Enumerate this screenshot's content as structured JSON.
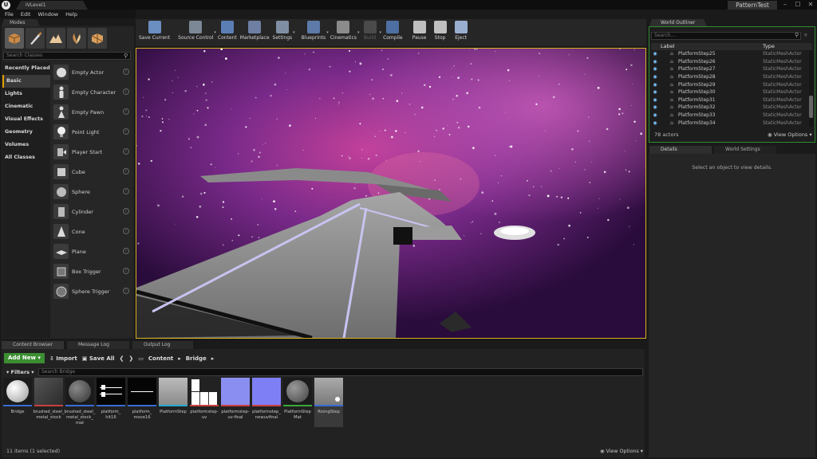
{
  "titlebar": {
    "level_tab": "IVLevel1",
    "project": "PatternTest",
    "min": "–",
    "max": "☐",
    "close": "✕"
  },
  "menu": [
    "File",
    "Edit",
    "Window",
    "Help"
  ],
  "modes": {
    "tab": "Modes",
    "search_placeholder": "Search Classes",
    "categories": [
      "Recently Placed",
      "Basic",
      "Lights",
      "Cinematic",
      "Visual Effects",
      "Geometry",
      "Volumes",
      "All Classes"
    ],
    "selected_category": "Basic",
    "actors": [
      "Empty Actor",
      "Empty Character",
      "Empty Pawn",
      "Point Light",
      "Player Start",
      "Cube",
      "Sphere",
      "Cylinder",
      "Cone",
      "Plane",
      "Box Trigger",
      "Sphere Trigger"
    ]
  },
  "toolbar": [
    {
      "label": "Save Current",
      "icon": "save-icon",
      "color": "#6a8fc0"
    },
    {
      "label": "Source Control",
      "icon": "source-control-icon",
      "color": "#7c8896",
      "arrow": true
    },
    {
      "label": "Content",
      "icon": "content-icon",
      "color": "#5b7fb5"
    },
    {
      "label": "Marketplace",
      "icon": "marketplace-icon",
      "color": "#6e7fa3"
    },
    {
      "label": "Settings",
      "icon": "settings-icon",
      "color": "#7f8ea3",
      "arrow": true
    },
    {
      "label": "Blueprints",
      "icon": "blueprints-icon",
      "color": "#5d7aa8",
      "arrow": true
    },
    {
      "label": "Cinematics",
      "icon": "cinematics-icon",
      "color": "#8b8b8b",
      "arrow": true
    },
    {
      "label": "Build",
      "icon": "build-icon",
      "color": "#4a4a4a",
      "arrow": true,
      "dim": true
    },
    {
      "label": "Compile",
      "icon": "compile-icon",
      "color": "#4d6fa1"
    },
    {
      "label": "Pause",
      "icon": "pause-icon",
      "color": "#bfbfbf"
    },
    {
      "label": "Stop",
      "icon": "stop-icon",
      "color": "#bfbfbf"
    },
    {
      "label": "Eject",
      "icon": "eject-icon",
      "color": "#9aaed0"
    }
  ],
  "outliner": {
    "tab": "World Outliner",
    "search_placeholder": "Search...",
    "col_label": "Label",
    "col_type": "Type",
    "rows": [
      {
        "label": "PlatformStep25",
        "type": "StaticMeshActor"
      },
      {
        "label": "PlatformStep26",
        "type": "StaticMeshActor"
      },
      {
        "label": "PlatformStep27",
        "type": "StaticMeshActor"
      },
      {
        "label": "PlatformStep28",
        "type": "StaticMeshActor"
      },
      {
        "label": "PlatformStep29",
        "type": "StaticMeshActor"
      },
      {
        "label": "PlatformStep30",
        "type": "StaticMeshActor"
      },
      {
        "label": "PlatformStep31",
        "type": "StaticMeshActor"
      },
      {
        "label": "PlatformStep32",
        "type": "StaticMeshActor"
      },
      {
        "label": "PlatformStep33",
        "type": "StaticMeshActor"
      },
      {
        "label": "PlatformStep34",
        "type": "StaticMeshActor"
      }
    ],
    "count": "78 actors",
    "view_options": "View Options"
  },
  "details": {
    "tab": "Details",
    "world_settings_tab": "World Settings",
    "empty_msg": "Select an object to view details."
  },
  "bottom_tabs": [
    "Content Browser",
    "Message Log",
    "Output Log"
  ],
  "content_browser": {
    "add_new": "Add New",
    "import": "Import",
    "save_all": "Save All",
    "crumbs": [
      "Content",
      "Bridge"
    ],
    "filters": "Filters",
    "search_placeholder": "Search Bridge",
    "assets": [
      {
        "name": "Bridge",
        "bar": "#3a6bd6",
        "kind": "sphere-white"
      },
      {
        "name": "brushed_steel_\nmetal_stock",
        "bar": "#c84040",
        "kind": "dark"
      },
      {
        "name": "brushed_steel_\nmetal_stock_\nmat",
        "bar": "#3a6bd6",
        "kind": "sphere-dark"
      },
      {
        "name": "platform_\nhit16",
        "bar": "#3a6bd6",
        "kind": "black-lines"
      },
      {
        "name": "platform_\nmove16",
        "bar": "#3a6bd6",
        "kind": "black-line"
      },
      {
        "name": "PlatformStep",
        "bar": "#25a8d0",
        "kind": "grey"
      },
      {
        "name": "platformstep-\nuv",
        "bar": "#c84040",
        "kind": "uv"
      },
      {
        "name": "platformstep-\nuv-final",
        "bar": "#c84040",
        "kind": "blue"
      },
      {
        "name": "platformstep_\nnewuvfinal",
        "bar": "#c84040",
        "kind": "normal"
      },
      {
        "name": "PlatformStep\nMat",
        "bar": "#3aa83a",
        "kind": "sphere-stone"
      },
      {
        "name": "RisingStep",
        "bar": "#3a6bd6",
        "kind": "mesh"
      }
    ],
    "selected_asset": "RisingStep",
    "status": "11 items (1 selected)",
    "view_options": "View Options"
  }
}
